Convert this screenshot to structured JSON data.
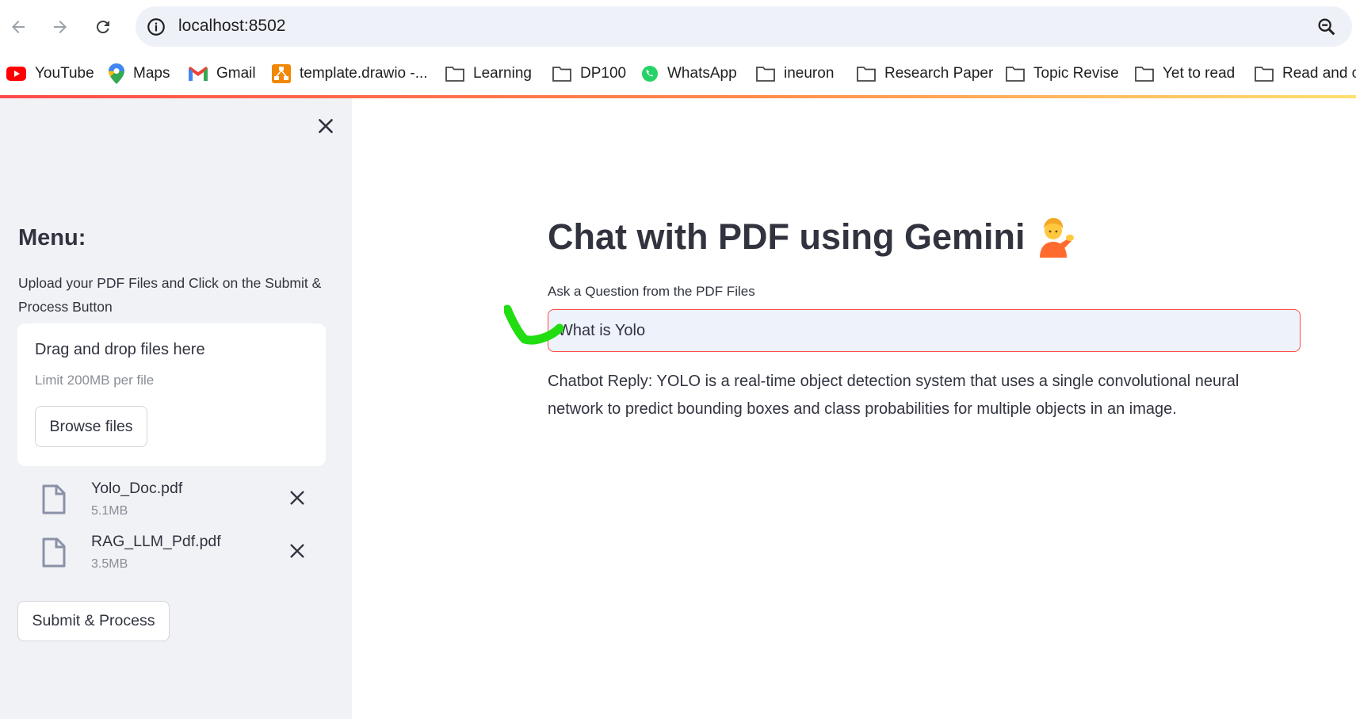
{
  "browser": {
    "url": "localhost:8502",
    "bookmarks": [
      {
        "label": "YouTube",
        "icon": "youtube-icon"
      },
      {
        "label": "Maps",
        "icon": "maps-icon"
      },
      {
        "label": "Gmail",
        "icon": "gmail-icon"
      },
      {
        "label": "template.drawio -...",
        "icon": "drawio-icon"
      },
      {
        "label": "Learning",
        "icon": "folder-icon"
      },
      {
        "label": "DP100",
        "icon": "folder-icon"
      },
      {
        "label": "WhatsApp",
        "icon": "whatsapp-icon"
      },
      {
        "label": "ineuron",
        "icon": "folder-icon"
      },
      {
        "label": "Research Paper",
        "icon": "folder-icon"
      },
      {
        "label": "Topic Revise",
        "icon": "folder-icon"
      },
      {
        "label": "Yet to read",
        "icon": "folder-icon"
      },
      {
        "label": "Read and c",
        "icon": "folder-icon"
      }
    ]
  },
  "sidebar": {
    "heading": "Menu:",
    "description": "Upload your PDF Files and Click on the Submit & Process Button",
    "dropzone": {
      "title": "Drag and drop files here",
      "limit": "Limit 200MB per file",
      "browse_label": "Browse files"
    },
    "files": [
      {
        "name": "Yolo_Doc.pdf",
        "size": "5.1MB"
      },
      {
        "name": "RAG_LLM_Pdf.pdf",
        "size": "3.5MB"
      }
    ],
    "submit_label": "Submit & Process"
  },
  "main": {
    "title": "Chat with PDF using Gemini",
    "title_emoji": "person-tipping-hand-icon",
    "question_label": "Ask a Question from the PDF Files",
    "question_value": "What is Yolo",
    "reply": "Chatbot Reply: YOLO is a real-time object detection system that uses a single convolutional neural network to predict bounding boxes and class probabilities for multiple objects in an image."
  },
  "colors": {
    "accent": "#ff4b4b",
    "sidebar_bg": "#f0f2f6",
    "annotation": "#22dd11"
  }
}
